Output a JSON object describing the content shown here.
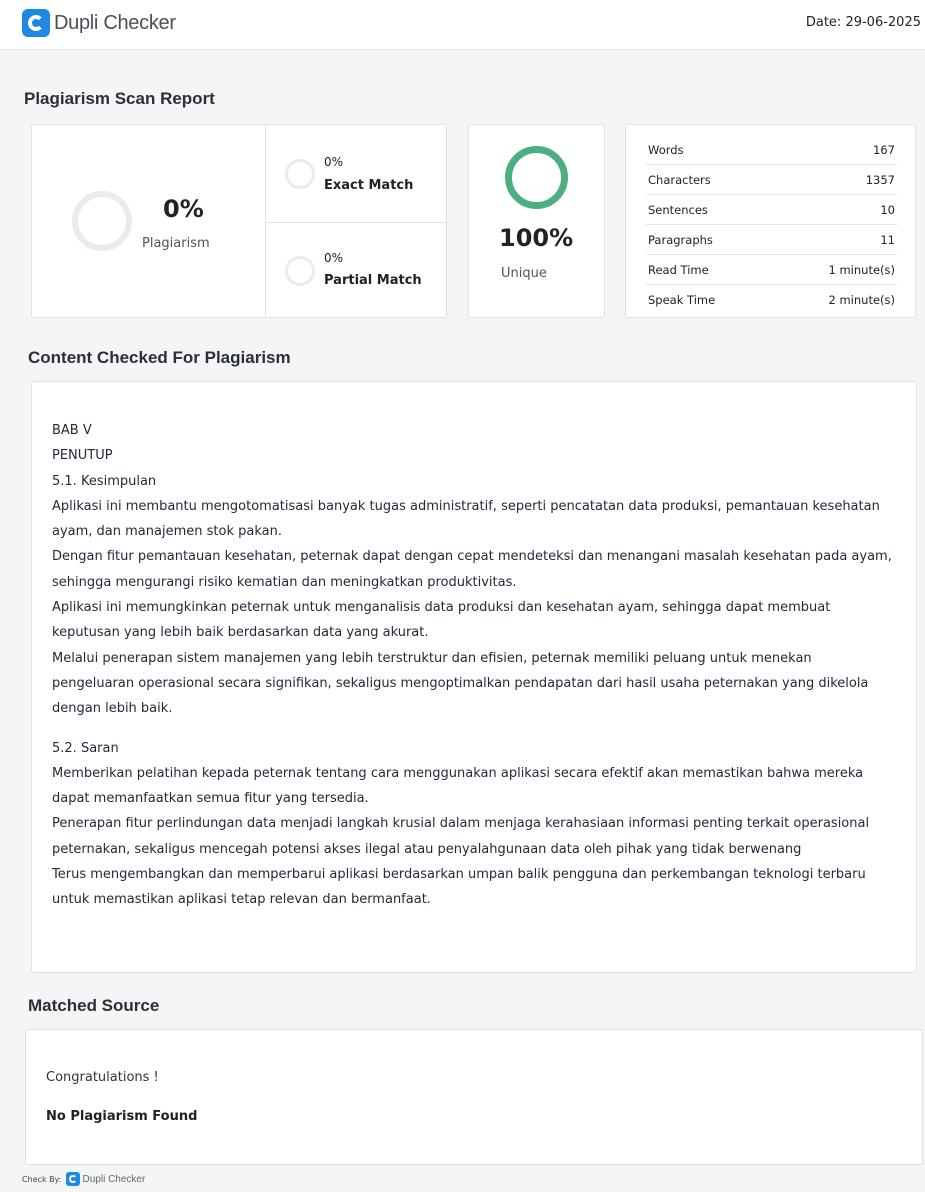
{
  "header": {
    "brand": "Dupli Checker",
    "date": "Date: 29-06-2025"
  },
  "report": {
    "title": "Plagiarism Scan Report",
    "plagiarism": {
      "value": "0%",
      "label": "Plagiarism",
      "level": 0
    },
    "exact_match": {
      "value": "0%",
      "label": "Exact Match",
      "level": 0
    },
    "partial_match": {
      "value": "0%",
      "label": "Partial Match",
      "level": 0
    },
    "unique": {
      "value": "100%",
      "label": "Unique",
      "level": 100
    },
    "accent_color": "#4caf83",
    "stats": [
      {
        "label": "Words",
        "value": "167"
      },
      {
        "label": "Characters",
        "value": "1357"
      },
      {
        "label": "Sentences",
        "value": "10"
      },
      {
        "label": "Paragraphs",
        "value": "11"
      },
      {
        "label": "Read Time",
        "value": "1 minute(s)"
      },
      {
        "label": "Speak Time",
        "value": "2 minute(s)"
      }
    ]
  },
  "content": {
    "title": "Content Checked For Plagiarism",
    "lines": [
      "BAB V",
      "PENUTUP",
      "5.1. Kesimpulan",
      "Aplikasi ini membantu mengotomatisasi banyak tugas administratif, seperti pencatatan data produksi, pemantauan kesehatan ayam, dan manajemen stok pakan.",
      "Dengan fitur pemantauan kesehatan, peternak dapat dengan cepat mendeteksi dan menangani masalah kesehatan pada ayam, sehingga mengurangi risiko kematian dan meningkatkan produktivitas.",
      "Aplikasi ini memungkinkan peternak untuk menganalisis data produksi dan kesehatan ayam, sehingga dapat membuat keputusan yang lebih baik berdasarkan data yang akurat.",
      "Melalui penerapan sistem manajemen yang lebih terstruktur dan efisien, peternak memiliki peluang untuk menekan pengeluaran operasional secara signifikan, sekaligus mengoptimalkan pendapatan dari hasil usaha peternakan yang dikelola dengan lebih baik.",
      "",
      "5.2. Saran",
      "Memberikan pelatihan kepada peternak tentang cara menggunakan aplikasi secara efektif akan memastikan bahwa mereka dapat memanfaatkan semua fitur yang tersedia.",
      "Penerapan fitur perlindungan data menjadi langkah krusial dalam menjaga kerahasiaan informasi penting terkait operasional peternakan, sekaligus mencegah potensi akses ilegal atau penyalahgunaan data oleh pihak yang tidak berwenang",
      "Terus mengembangkan dan memperbarui aplikasi berdasarkan umpan balik pengguna dan perkembangan teknologi terbaru untuk memastikan aplikasi tetap relevan dan bermanfaat."
    ]
  },
  "matched": {
    "title": "Matched Source",
    "congrats": "Congratulations !",
    "result": "No Plagiarism Found"
  },
  "footer": {
    "check_by": "Check By:",
    "brand": "Dupli Checker"
  }
}
